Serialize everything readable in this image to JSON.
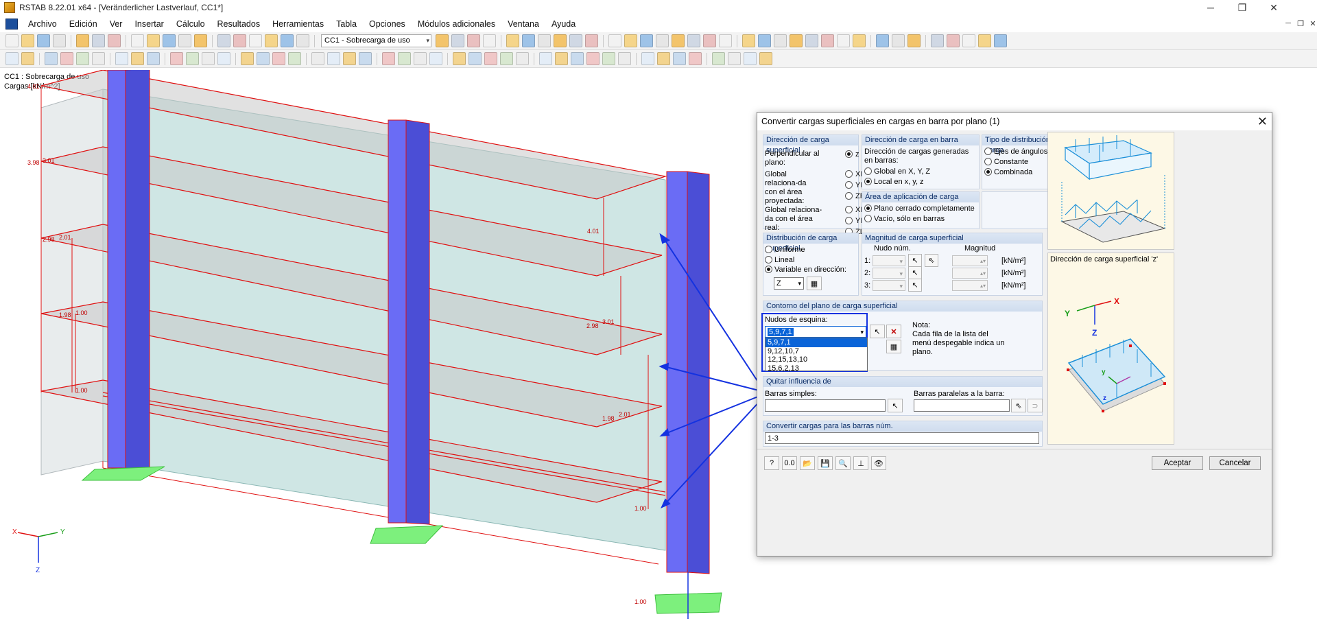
{
  "window": {
    "title": "RSTAB 8.22.01 x64 - [Veränderlicher Lastverlauf, CC1*]"
  },
  "menu": [
    "Archivo",
    "Edición",
    "Ver",
    "Insertar",
    "Cálculo",
    "Resultados",
    "Herramientas",
    "Tabla",
    "Opciones",
    "Módulos adicionales",
    "Ventana",
    "Ayuda"
  ],
  "toolbar": {
    "load_case": "CC1 - Sobrecarga de uso"
  },
  "viewport": {
    "case_label": "CC1 : Sobrecarga de uso",
    "units_label": "Cargas [kN/m^2]",
    "load_values": [
      "4.01",
      "3.98",
      "3.01",
      "2.98",
      "2.01",
      "1.98",
      "1.00",
      "1.00",
      "4.01",
      "3.01",
      "2.98",
      "2.01",
      "1.98",
      "1.00",
      "1.00"
    ],
    "axes": {
      "x": "X",
      "y": "Y",
      "z": "Z"
    }
  },
  "dialog": {
    "title": "Convertir cargas superficiales en cargas en barra por plano   (1)",
    "dir_surface": {
      "header": "Dirección de carga superficial",
      "perpendicular": "Perpendicular al plano:",
      "global_projected": "Global relaciona-da con el área proyectada:",
      "global_real": "Global relaciona-da con el área real:",
      "options": [
        "z",
        "XP",
        "YP",
        "ZP",
        "XL",
        "YL",
        "ZL"
      ]
    },
    "dir_bar": {
      "header": "Dirección de carga en barra",
      "desc": "Dirección de cargas generadas en barras:",
      "global": "Global en X, Y, Z",
      "local": "Local en x, y, z"
    },
    "dist_type": {
      "header": "Tipo de distribución de carga",
      "angles": "Ejes de ángulos",
      "constant": "Constante",
      "combined": "Combinada"
    },
    "area": {
      "header": "Área de aplicación de carga",
      "closed": "Plano cerrado completamente",
      "empty": "Vacío, sólo en barras"
    },
    "surf_dist": {
      "header": "Distribución de carga superficial",
      "uniform": "Uniforme",
      "linear": "Lineal",
      "variable": "Variable en dirección:",
      "direction": "Z"
    },
    "magnitude": {
      "header": "Magnitud de carga superficial",
      "col_node": "Nudo núm.",
      "col_mag": "Magnitud",
      "rows": [
        "1:",
        "2:",
        "3:"
      ],
      "unit": "[kN/m²]"
    },
    "contour": {
      "header": "Contorno del plano de carga superficial",
      "corners_label": "Nudos de esquina:",
      "selected": "5,9,7,1",
      "options": [
        "5,9,7,1",
        "9,12,10,7",
        "12,15,13,10",
        "15,6,2,13"
      ],
      "note_title": "Nota:",
      "note_text": "Cada fila de la lista del menú despegable indica un plano."
    },
    "remove": {
      "header": "Quitar influencia de",
      "simple": "Barras simples:",
      "parallel": "Barras paralelas a la barra:"
    },
    "convert": {
      "header": "Convertir cargas para las barras núm.",
      "value": "1-3"
    },
    "illus_caption": "Dirección de carga superficial 'z'",
    "illus_axes": {
      "x": "X",
      "y": "Y",
      "z": "Z",
      "small_y": "y",
      "small_z": "z"
    },
    "ok": "Aceptar",
    "cancel": "Cancelar"
  }
}
